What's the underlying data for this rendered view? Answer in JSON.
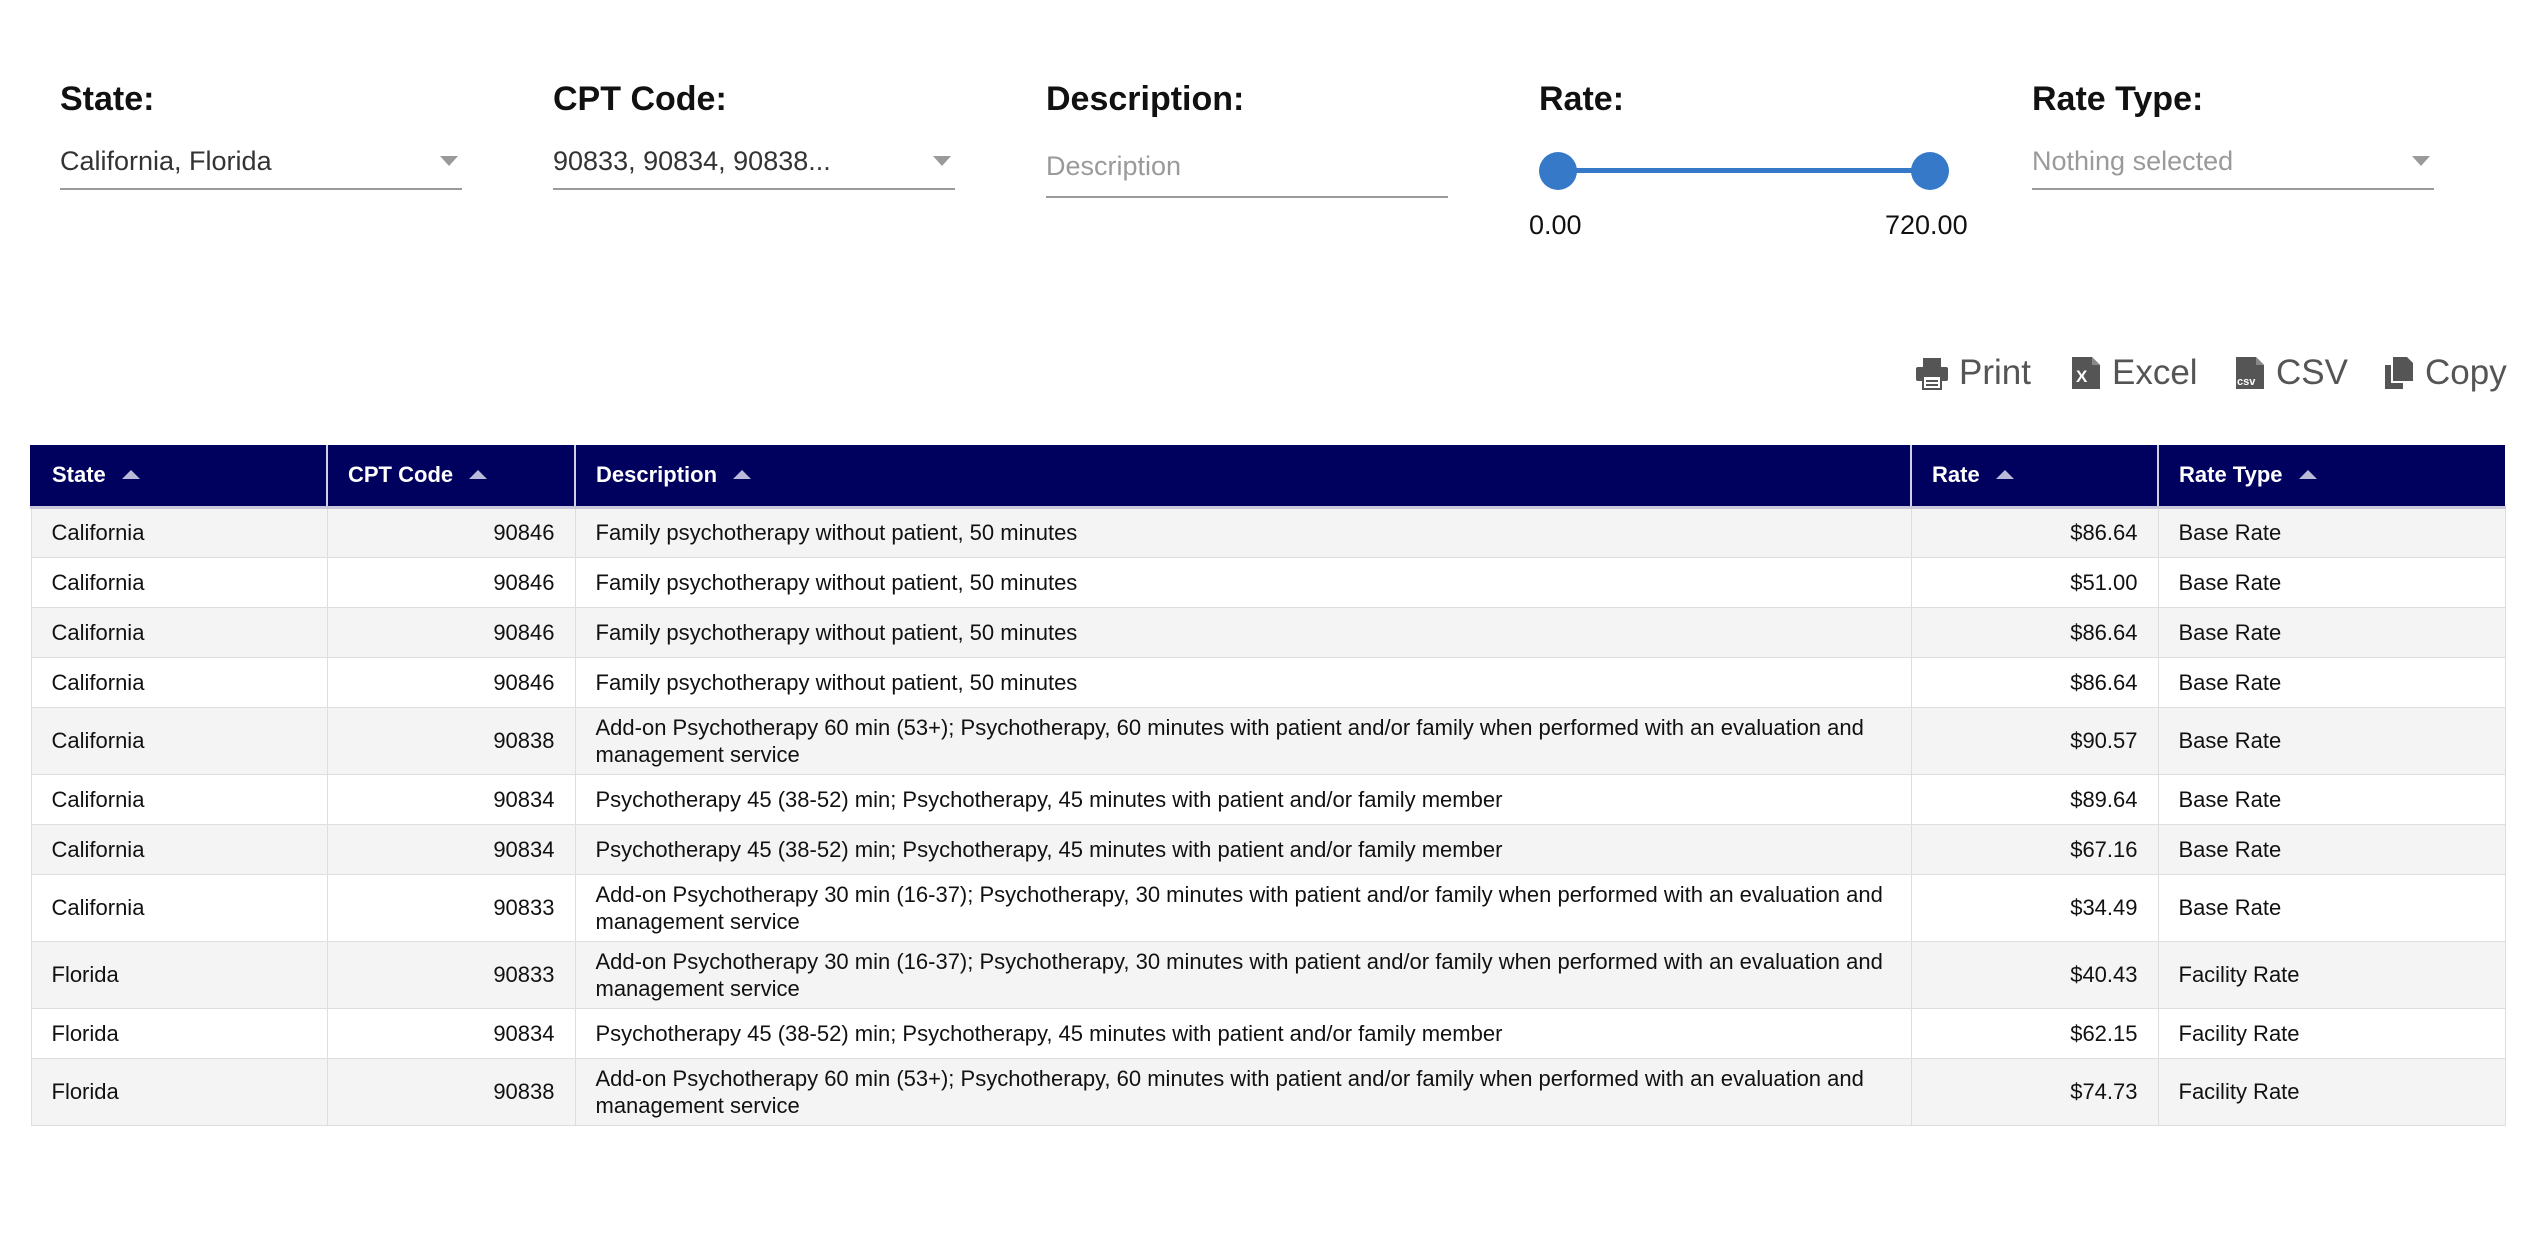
{
  "filters": {
    "state": {
      "label": "State:",
      "value": "California, Florida"
    },
    "cpt": {
      "label": "CPT Code:",
      "value": "90833, 90834, 90838..."
    },
    "description": {
      "label": "Description:",
      "placeholder": "Description",
      "value": ""
    },
    "rate": {
      "label": "Rate:",
      "min_label": "0.00",
      "max_label": "720.00",
      "min": 0.0,
      "max": 720.0
    },
    "rate_type": {
      "label": "Rate Type:",
      "placeholder": "Nothing selected"
    }
  },
  "toolbar": {
    "print_label": "Print",
    "excel_label": "Excel",
    "csv_label": "CSV",
    "copy_label": "Copy"
  },
  "table": {
    "headers": {
      "state": "State",
      "cpt": "CPT Code",
      "description": "Description",
      "rate": "Rate",
      "rate_type": "Rate Type"
    },
    "rows": [
      {
        "state": "California",
        "cpt": "90846",
        "description": "Family psychotherapy without patient, 50 minutes",
        "rate": "$86.64",
        "rate_type": "Base Rate"
      },
      {
        "state": "California",
        "cpt": "90846",
        "description": "Family psychotherapy without patient, 50 minutes",
        "rate": "$51.00",
        "rate_type": "Base Rate"
      },
      {
        "state": "California",
        "cpt": "90846",
        "description": "Family psychotherapy without patient, 50 minutes",
        "rate": "$86.64",
        "rate_type": "Base Rate"
      },
      {
        "state": "California",
        "cpt": "90846",
        "description": "Family psychotherapy without patient, 50 minutes",
        "rate": "$86.64",
        "rate_type": "Base Rate"
      },
      {
        "state": "California",
        "cpt": "90838",
        "description": "Add-on Psychotherapy 60 min (53+); Psychotherapy, 60 minutes with patient and/or family when performed with an evaluation and management service",
        "rate": "$90.57",
        "rate_type": "Base Rate"
      },
      {
        "state": "California",
        "cpt": "90834",
        "description": "Psychotherapy 45 (38-52) min; Psychotherapy, 45 minutes with patient and/or family member",
        "rate": "$89.64",
        "rate_type": "Base Rate"
      },
      {
        "state": "California",
        "cpt": "90834",
        "description": "Psychotherapy 45 (38-52) min; Psychotherapy, 45 minutes with patient and/or family member",
        "rate": "$67.16",
        "rate_type": "Base Rate"
      },
      {
        "state": "California",
        "cpt": "90833",
        "description": "Add-on Psychotherapy 30 min (16-37); Psychotherapy, 30 minutes with patient and/or family when performed with an evaluation and management service",
        "rate": "$34.49",
        "rate_type": "Base Rate"
      },
      {
        "state": "Florida",
        "cpt": "90833",
        "description": "Add-on Psychotherapy 30 min (16-37); Psychotherapy, 30 minutes with patient and/or family when performed with an evaluation and management service",
        "rate": "$40.43",
        "rate_type": "Facility Rate"
      },
      {
        "state": "Florida",
        "cpt": "90834",
        "description": "Psychotherapy 45 (38-52) min; Psychotherapy, 45 minutes with patient and/or family member",
        "rate": "$62.15",
        "rate_type": "Facility Rate"
      },
      {
        "state": "Florida",
        "cpt": "90838",
        "description": "Add-on Psychotherapy 60 min (53+); Psychotherapy, 60 minutes with patient and/or family when performed with an evaluation and management service",
        "rate": "$74.73",
        "rate_type": "Facility Rate"
      }
    ]
  },
  "colors": {
    "header_bg": "#00005f",
    "accent": "#3579c8",
    "row_alt": "#f4f4f4"
  }
}
